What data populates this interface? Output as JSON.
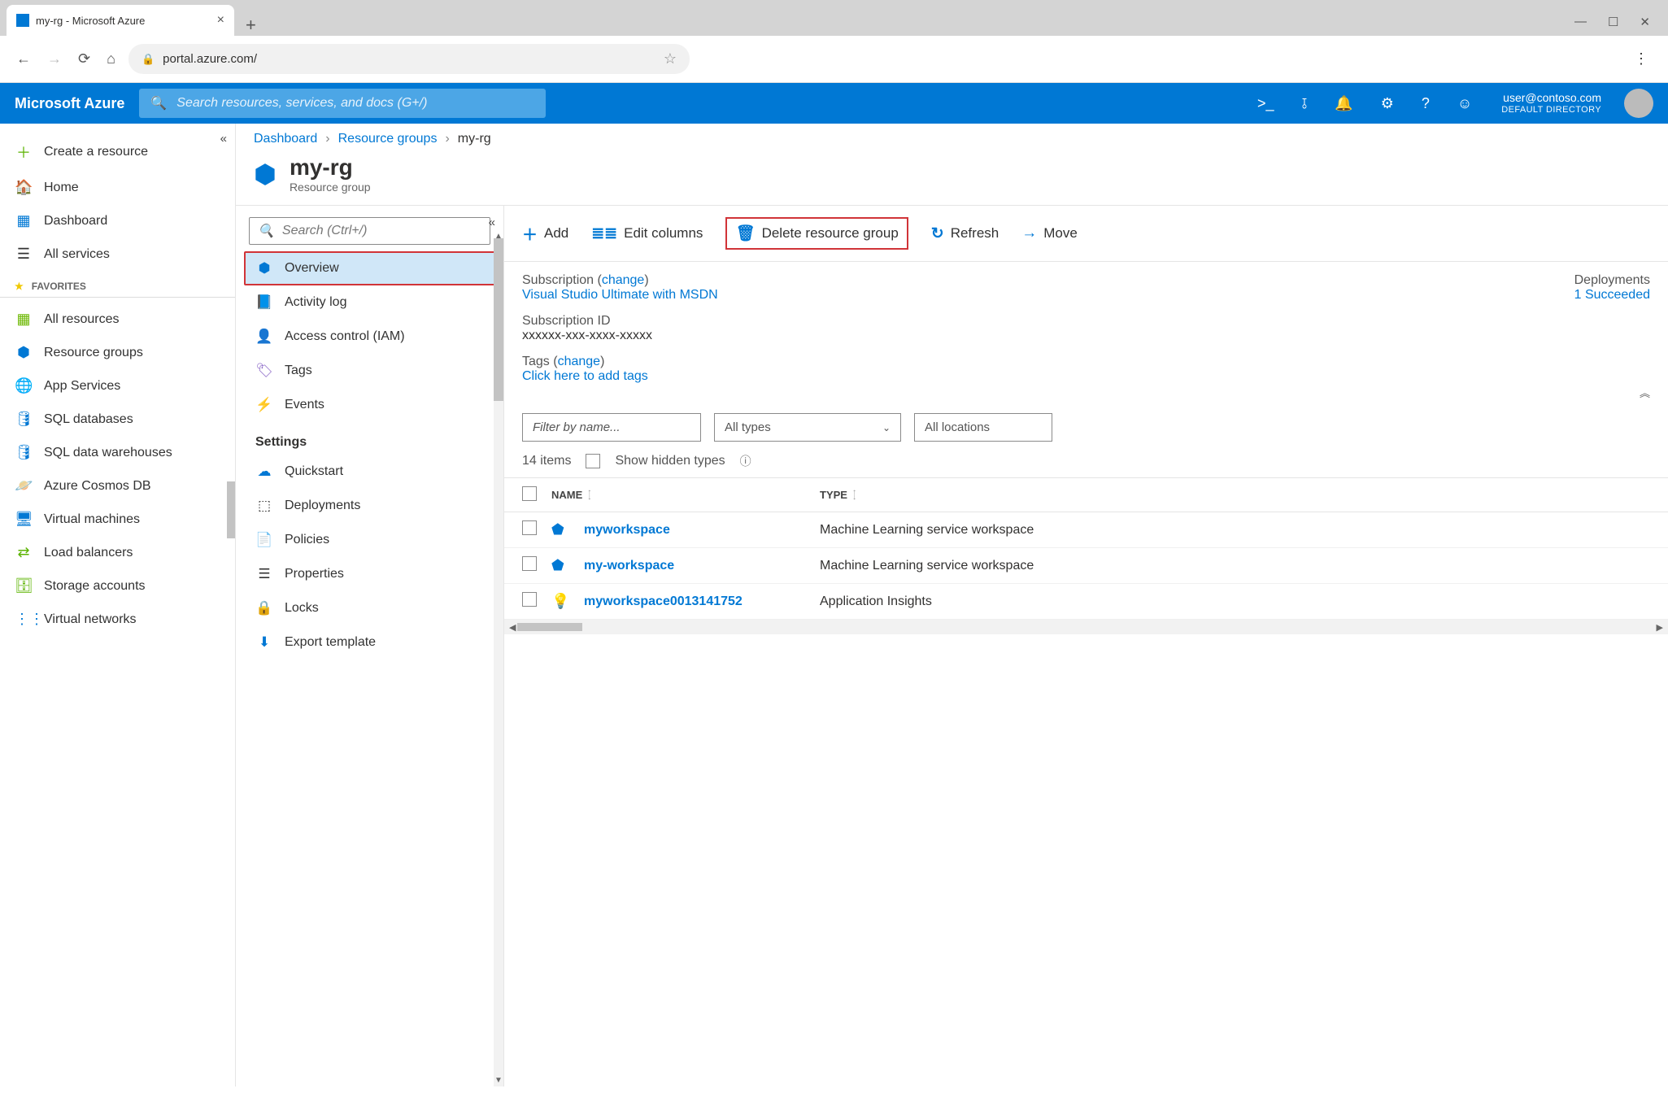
{
  "browser": {
    "tab_title": "my-rg - Microsoft Azure",
    "url": "portal.azure.com/"
  },
  "azure_header": {
    "brand": "Microsoft Azure",
    "search_placeholder": "Search resources, services, and docs (G+/)",
    "user_email": "user@contoso.com",
    "user_directory": "DEFAULT DIRECTORY"
  },
  "left_nav": {
    "create": "Create a resource",
    "home": "Home",
    "dashboard": "Dashboard",
    "all_services": "All services",
    "favorites_header": "FAVORITES",
    "favorites": [
      "All resources",
      "Resource groups",
      "App Services",
      "SQL databases",
      "SQL data warehouses",
      "Azure Cosmos DB",
      "Virtual machines",
      "Load balancers",
      "Storage accounts",
      "Virtual networks"
    ]
  },
  "breadcrumbs": {
    "dashboard": "Dashboard",
    "resource_groups": "Resource groups",
    "current": "my-rg"
  },
  "title": {
    "name": "my-rg",
    "subtitle": "Resource group"
  },
  "inner_nav": {
    "search_placeholder": "Search (Ctrl+/)",
    "overview": "Overview",
    "activity_log": "Activity log",
    "access_control": "Access control (IAM)",
    "tags": "Tags",
    "events": "Events",
    "settings_header": "Settings",
    "quickstart": "Quickstart",
    "deployments": "Deployments",
    "policies": "Policies",
    "properties": "Properties",
    "locks": "Locks",
    "export_template": "Export template"
  },
  "toolbar": {
    "add": "Add",
    "edit_columns": "Edit columns",
    "delete_rg": "Delete resource group",
    "refresh": "Refresh",
    "move": "Move"
  },
  "essentials": {
    "sub_label": "Subscription",
    "change": "change",
    "sub_value": "Visual Studio Ultimate with MSDN",
    "sub_id_label": "Subscription ID",
    "sub_id_value": "xxxxxx-xxx-xxxx-xxxxx",
    "tags_label": "Tags",
    "tags_value": "Click here to add tags",
    "deployments_label": "Deployments",
    "deployments_value": "1 Succeeded"
  },
  "filters": {
    "filter_placeholder": "Filter by name...",
    "types": "All types",
    "locations": "All locations"
  },
  "count": {
    "items": "14 items",
    "show_hidden": "Show hidden types"
  },
  "table": {
    "col_name": "NAME",
    "col_type": "TYPE",
    "rows": [
      {
        "name": "myworkspace",
        "type": "Machine Learning service workspace",
        "icon": "ml"
      },
      {
        "name": "my-workspace",
        "type": "Machine Learning service workspace",
        "icon": "ml"
      },
      {
        "name": "myworkspace0013141752",
        "type": "Application Insights",
        "icon": "ai"
      }
    ]
  }
}
